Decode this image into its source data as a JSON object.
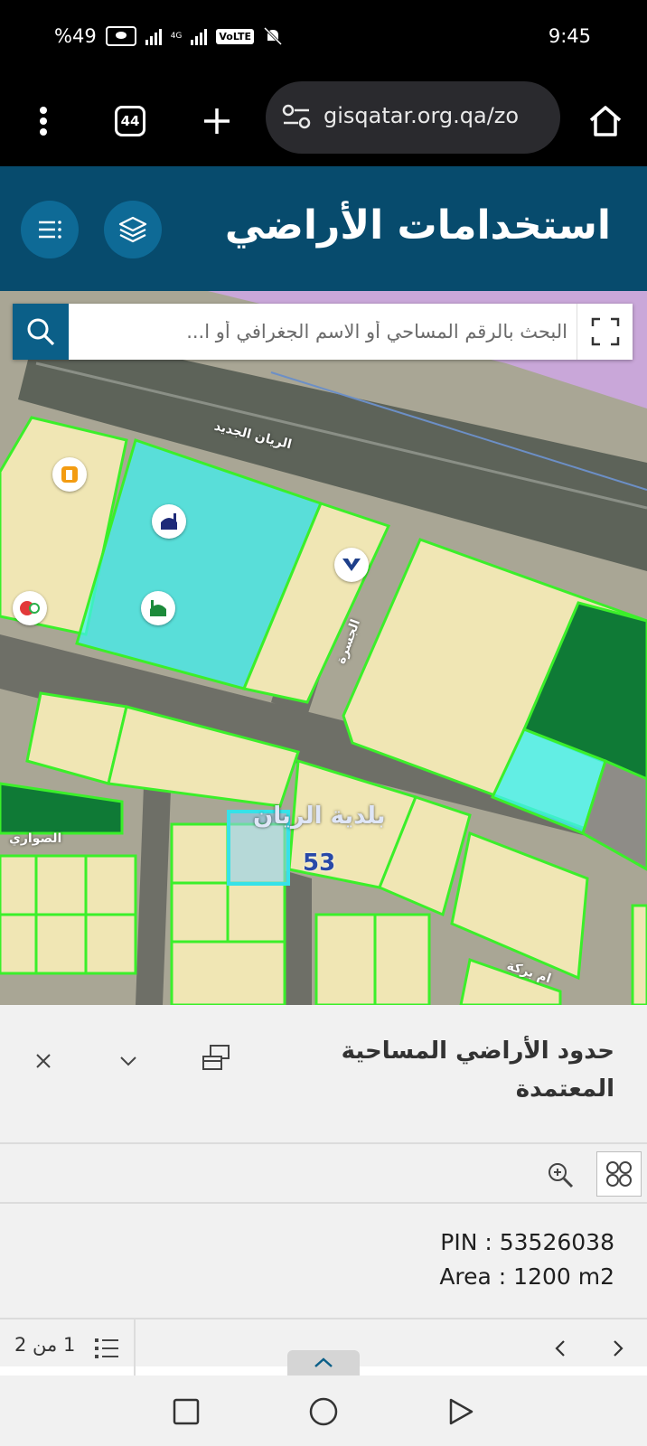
{
  "status_bar": {
    "battery": "%49",
    "network_small": "4G",
    "volte": "VoLTE",
    "time": "9:45"
  },
  "browser": {
    "tab_count": "44",
    "url": "gisqatar.org.qa/zo"
  },
  "app": {
    "title": "استخدامات الأراضي"
  },
  "search": {
    "placeholder": "البحث بالرقم المساحي أو الاسم الجغرافي أو ا..."
  },
  "map": {
    "labels": {
      "road_rayyan_new": "الريان الجديد",
      "road_jasra": "الجسرة",
      "road_sawari": "الصواري",
      "road_umm_barka": "ام بركة",
      "municipality": "بلدية الريان",
      "zone_number": "53"
    },
    "colors": {
      "parcel_outline": "#3bef2a",
      "selected_outline": "#36e2e8",
      "residential_fill": "#f0e6b4",
      "mosque_fill": "#3ff0f0",
      "park_fill": "#0f7a36",
      "purple_zone": "#c9a7d9"
    },
    "pois": [
      "fuel-station",
      "mosque",
      "mosque",
      "restaurant",
      "shopping"
    ]
  },
  "panel": {
    "title": "حدود الأراضي المساحية المعتمدة",
    "pin_line": "PIN : 53526038",
    "area_line": "Area : 1200 m2",
    "page_label": "1 من 2"
  }
}
